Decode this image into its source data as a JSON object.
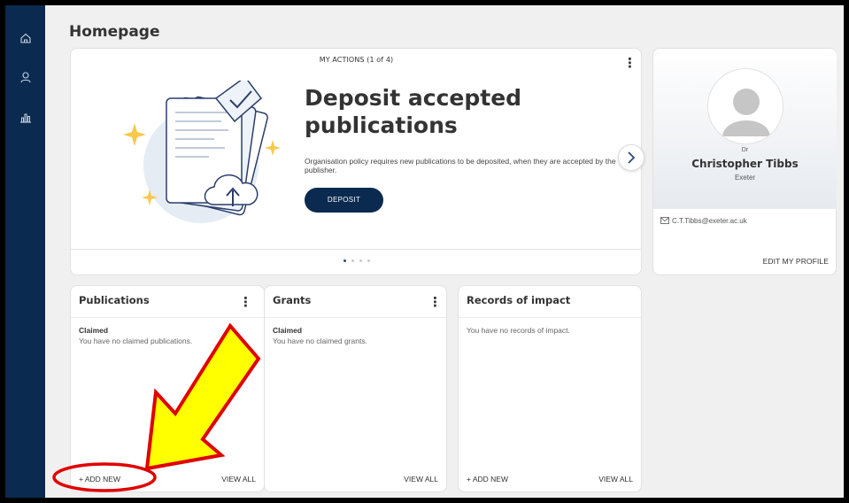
{
  "page": {
    "title": "Homepage"
  },
  "sidebar": {
    "items": [
      {
        "icon": "home-icon"
      },
      {
        "icon": "user-icon"
      },
      {
        "icon": "bar-chart-icon"
      }
    ]
  },
  "actions_card": {
    "label": "MY ACTIONS (1 of 4)",
    "headline": "Deposit accepted publications",
    "description": "Organisation policy requires new publications to be deposited, when they are accepted by the publisher.",
    "button_label": "DEPOSIT",
    "carousel": {
      "current": 1,
      "total": 4
    }
  },
  "profile": {
    "honorific": "Dr",
    "name": "Christopher Tibbs",
    "organisation": "Exeter",
    "email": "C.T.Tibbs@exeter.ac.uk",
    "edit_label": "EDIT MY PROFILE"
  },
  "cards": [
    {
      "title": "Publications",
      "subtitle": "Claimed",
      "empty_text": "You have no claimed publications.",
      "add_label": "+ ADD NEW",
      "view_label": "VIEW ALL"
    },
    {
      "title": "Grants",
      "subtitle": "Claimed",
      "empty_text": "You have no claimed grants.",
      "view_label": "VIEW ALL"
    },
    {
      "title": "Records of impact",
      "empty_text": "You have no records of impact.",
      "add_label": "+ ADD NEW",
      "view_label": "VIEW ALL"
    }
  ],
  "colors": {
    "sidebar": "#0b2a4f",
    "primary_button": "#0b2a4f",
    "annotation_arrow_fill": "#ffff00",
    "annotation_arrow_stroke": "#e00000",
    "annotation_ellipse": "#e00000"
  }
}
